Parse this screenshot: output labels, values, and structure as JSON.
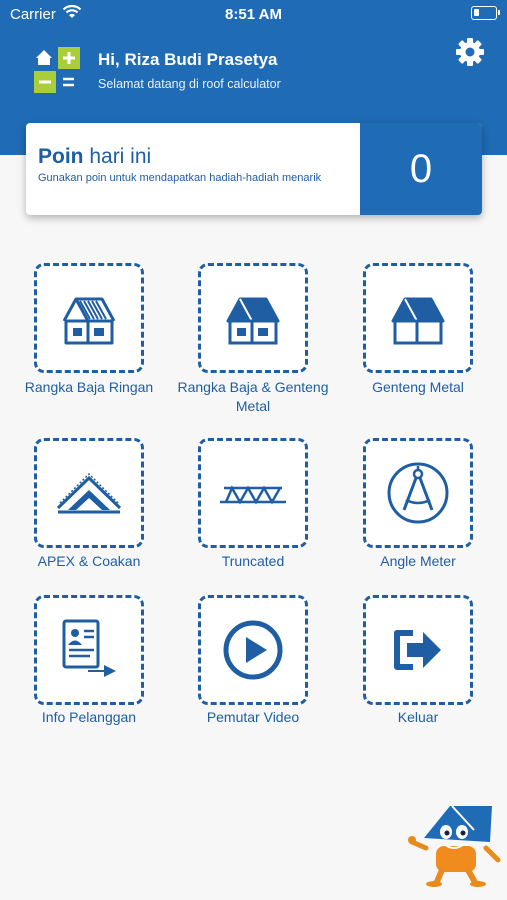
{
  "status_bar": {
    "carrier": "Carrier",
    "time": "8:51 AM"
  },
  "header": {
    "greeting": "Hi, Riza Budi Prasetya",
    "subtitle": "Selamat datang di roof calculator"
  },
  "poin": {
    "title_bold": "Poin",
    "title_rest": " hari ini",
    "description": "Gunakan poin untuk mendapatkan hadiah-hadiah menarik",
    "value": "0"
  },
  "menu": [
    {
      "label": "Rangka Baja Ringan",
      "icon": "house-truss-icon"
    },
    {
      "label": "Rangka Baja & Genteng Metal",
      "icon": "house-roof-icon"
    },
    {
      "label": "Genteng Metal",
      "icon": "house-metal-icon"
    },
    {
      "label": "APEX & Coakan",
      "icon": "apex-icon"
    },
    {
      "label": "Truncated",
      "icon": "truss-icon"
    },
    {
      "label": "Angle Meter",
      "icon": "compass-icon"
    },
    {
      "label": "Info Pelanggan",
      "icon": "customer-info-icon"
    },
    {
      "label": "Pemutar Video",
      "icon": "play-icon"
    },
    {
      "label": "Keluar",
      "icon": "exit-icon"
    }
  ],
  "colors": {
    "primary": "#1f6bb5",
    "text": "#1f5ea3",
    "logo_green": "#a8cf3a"
  }
}
